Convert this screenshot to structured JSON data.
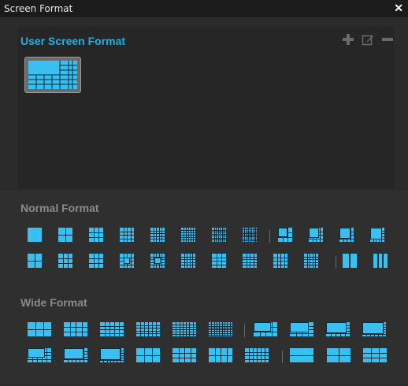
{
  "window": {
    "title": "Screen Format",
    "close_icon": "close-icon"
  },
  "user_section": {
    "label": "User Screen Format",
    "tools": [
      {
        "name": "add-icon",
        "glyph": "plus"
      },
      {
        "name": "edit-icon",
        "glyph": "pencil"
      },
      {
        "name": "remove-icon",
        "glyph": "minus"
      }
    ],
    "thumbnail": {
      "name": "user-layout-thumbnail"
    }
  },
  "normal_section": {
    "label": "Normal Format"
  },
  "wide_section": {
    "label": "Wide Format"
  },
  "colors": {
    "accent": "#29aeda",
    "icon_fill": "#3ac0f0",
    "icon_grid": "#0d2a3a",
    "label_gray": "#8a8a8a"
  }
}
